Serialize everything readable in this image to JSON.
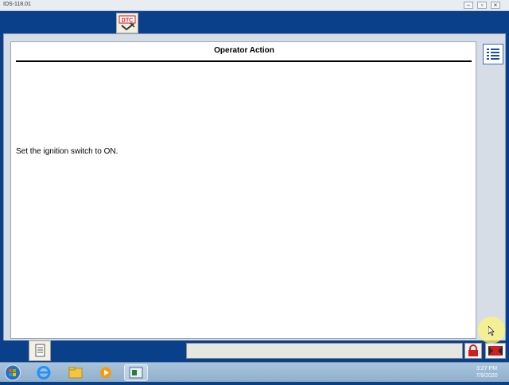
{
  "window": {
    "title": "IDS-118.01"
  },
  "toolbar": {
    "dtc_icon": "dtc-icon",
    "dtc_label": "DTC"
  },
  "content": {
    "heading": "Operator Action",
    "message": "Set the ignition switch to ON."
  },
  "side": {
    "list_icon": "list-icon"
  },
  "bottom": {
    "doc_icon": "document-icon",
    "lock_icon": "lock-icon",
    "exit_icon": "exit-icon",
    "status_text": ""
  },
  "taskbar": {
    "items": [
      "start-orb-icon",
      "internet-explorer-icon",
      "folder-icon",
      "media-player-icon",
      "ids-app-icon"
    ],
    "time": "3:27 PM",
    "date": "7/9/2020"
  },
  "colors": {
    "app_blue": "#0a3f8a",
    "lock_red": "#d11f1f"
  }
}
